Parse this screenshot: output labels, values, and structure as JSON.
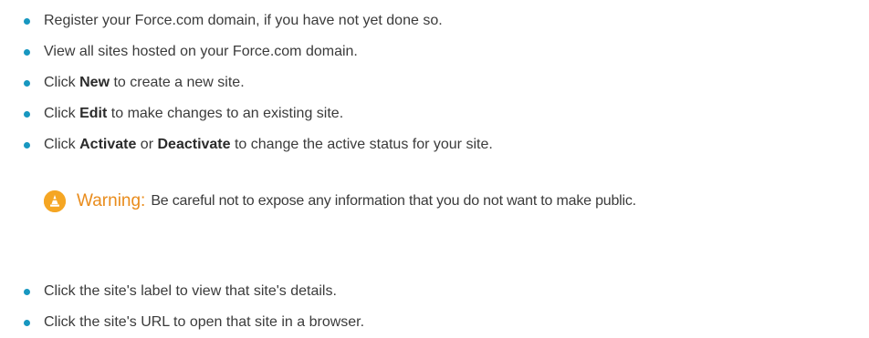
{
  "list_top": {
    "items": [
      {
        "plain": "Register your Force.com domain, if you have not yet done so."
      },
      {
        "plain": "View all sites hosted on your Force.com domain."
      },
      {
        "pre": "Click ",
        "b1": "New",
        "mid": " to create a new site."
      },
      {
        "pre": "Click ",
        "b1": "Edit",
        "mid": " to make changes to an existing site."
      },
      {
        "pre": "Click ",
        "b1": "Activate",
        "mid": " or ",
        "b2": "Deactivate",
        "post": " to change the active status for your site."
      }
    ]
  },
  "warning": {
    "icon": "warning-cone-icon",
    "label": "Warning:",
    "text": "Be careful not to expose any information that you do not want to make public.",
    "accent_color": "#e98c1c",
    "icon_color": "#f5a623"
  },
  "list_bottom": {
    "items": [
      {
        "plain": "Click the site's label to view that site's details."
      },
      {
        "plain": "Click the site's URL to open that site in a browser."
      }
    ]
  },
  "bullet_color": "#1797c0"
}
